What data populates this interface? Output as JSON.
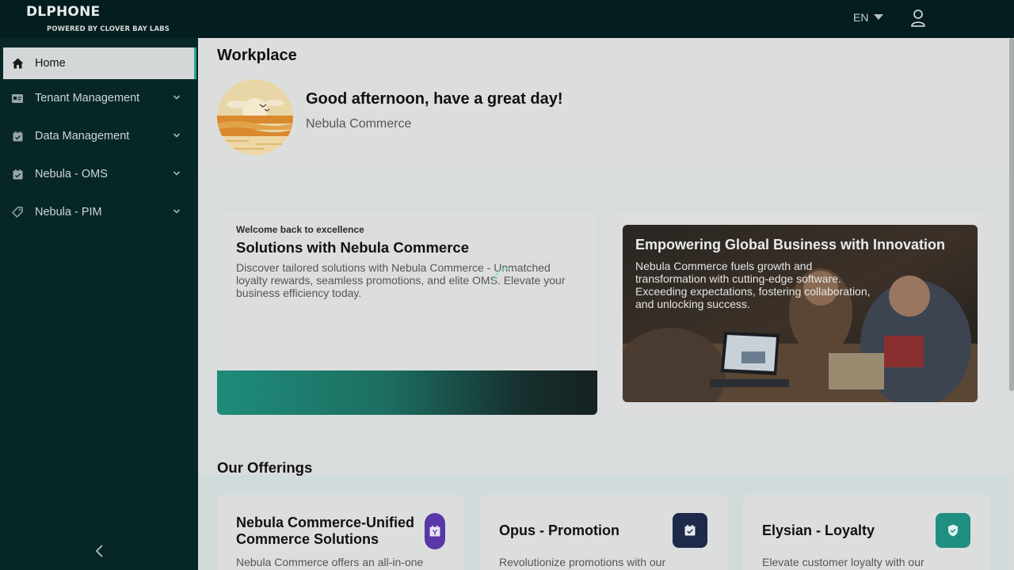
{
  "header": {
    "brand": "DLPHONE",
    "brand_sub": "POWERED BY CLOVER BAY LABS",
    "language": "EN",
    "user_icon": "user-icon"
  },
  "sidebar": {
    "items": [
      {
        "label": "Home",
        "icon": "home-icon",
        "active": true
      },
      {
        "label": "Tenant Management",
        "icon": "id-card-icon",
        "expandable": true
      },
      {
        "label": "Data Management",
        "icon": "calendar-check-icon",
        "expandable": true
      },
      {
        "label": "Nebula - OMS",
        "icon": "calendar-check-icon",
        "expandable": true
      },
      {
        "label": "Nebula - PIM",
        "icon": "tag-icon",
        "expandable": true
      }
    ],
    "collapse_icon": "chevron-left-icon"
  },
  "workplace": {
    "title": "Workplace",
    "greeting": "Good afternoon, have a great day!",
    "company": "Nebula Commerce"
  },
  "welcome_card": {
    "eyebrow": "Welcome back to excellence",
    "title": "Solutions with Nebula Commerce",
    "text": "Discover tailored solutions with Nebula Commerce - Unmatched loyalty rewards, seamless promotions, and elite OMS. Elevate your business efficiency today."
  },
  "hero_card": {
    "title": "Empowering Global Business with Innovation",
    "text": "Nebula Commerce fuels growth and transformation with cutting-edge software. Exceeding expectations, fostering collaboration, and unlocking success."
  },
  "offerings": {
    "title": "Our Offerings",
    "cards": [
      {
        "title_line1": "Nebula Commerce-Unified",
        "title_line2": "Commerce Solutions",
        "desc": "Nebula Commerce offers an all-in-one",
        "icon": "calendar-icon",
        "icon_color": "#5a37a8"
      },
      {
        "title_line1": "Opus - Promotion",
        "title_line2": "",
        "desc": "Revolutionize promotions with our",
        "icon": "calendar-check-icon",
        "icon_color": "#1e2a4a"
      },
      {
        "title_line1": "Elysian - Loyalty",
        "title_line2": "",
        "desc": "Elevate customer loyalty with our",
        "icon": "shield-check-icon",
        "icon_color": "#1e8f80"
      }
    ]
  },
  "colors": {
    "header_bg": "#041d1e",
    "sidebar_bg": "#072727",
    "accent": "#2aa39a"
  }
}
